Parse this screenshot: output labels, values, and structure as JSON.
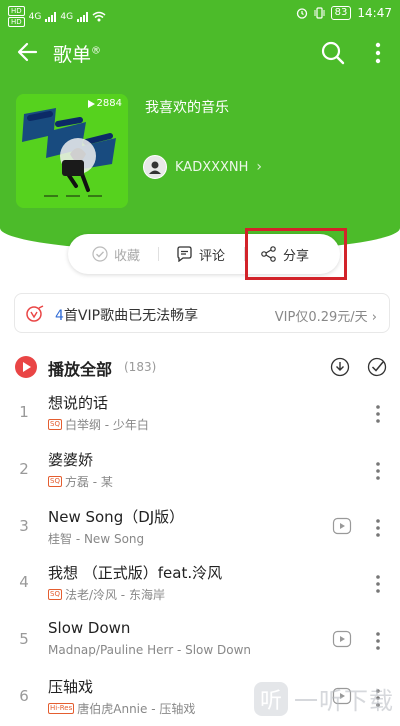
{
  "status_bar": {
    "sim1": "HD",
    "sim2": "HD",
    "net1": "4G",
    "net2": "4G",
    "battery": "83",
    "time": "14:47"
  },
  "nav": {
    "title": "歌单",
    "title_mark": "®"
  },
  "playlist": {
    "cover_count": "2884",
    "name": "我喜欢的音乐",
    "owner": "KADXXXNH"
  },
  "actions": {
    "collect": "收藏",
    "comment": "评论",
    "share": "分享"
  },
  "vip_banner": {
    "count": "4",
    "text": "首VIP歌曲已无法畅享",
    "price": "VIP仅0.29元/天"
  },
  "play_all": {
    "label": "播放全部",
    "count": "(183)"
  },
  "songs": [
    {
      "index": "1",
      "title": "想说的话",
      "badge": "SQ",
      "subtitle": "白举纲 - 少年白"
    },
    {
      "index": "2",
      "title": "婆婆娇",
      "badge": "SQ",
      "subtitle": "方磊 - 某"
    },
    {
      "index": "3",
      "title": "New Song（DJ版）",
      "badge": "",
      "subtitle": "桂智 - New Song"
    },
    {
      "index": "4",
      "title": "我想 （正式版）feat.泠风",
      "badge": "SQ",
      "subtitle": "法老/泠风 - 东海岸"
    },
    {
      "index": "5",
      "title": "Slow Down",
      "badge": "",
      "subtitle": "Madnap/Pauline Herr - Slow Down"
    },
    {
      "index": "6",
      "title": "压轴戏",
      "badge": "Hi-Res",
      "subtitle": "唐伯虎Annie - 压轴戏"
    }
  ],
  "watermark": {
    "logo": "听",
    "text": "一听下载"
  },
  "colors": {
    "header_green": "#4cbb2a",
    "play_red": "#e94545",
    "highlight_red": "#d2232a",
    "vip_blue": "#2f6bd6",
    "badge_orange": "#e45d2f"
  },
  "icons": [
    "back-arrow-icon",
    "search-icon",
    "more-vert-icon",
    "play-icon",
    "avatar-icon",
    "heart-circle-icon",
    "comment-icon",
    "share-icon",
    "vip-icon",
    "download-icon",
    "check-circle-icon",
    "mv-play-icon",
    "more-dots-icon"
  ]
}
